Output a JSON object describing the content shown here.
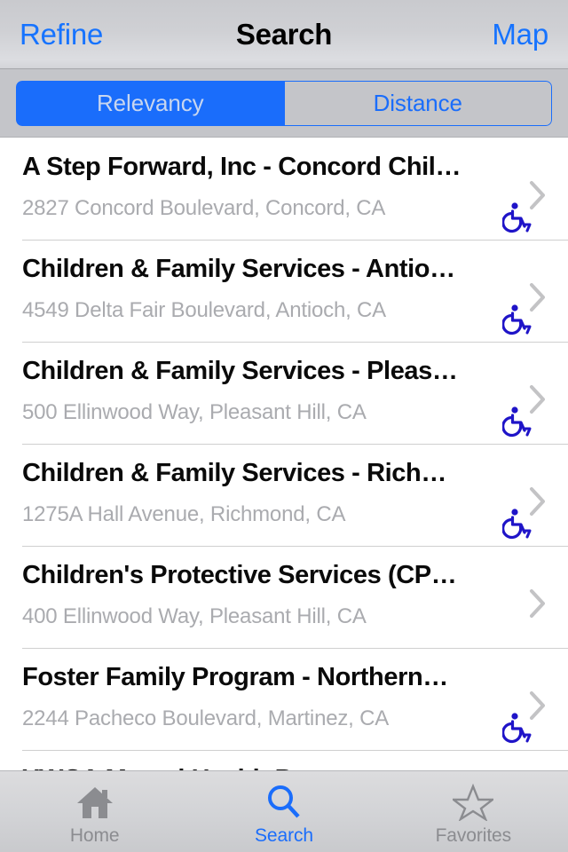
{
  "navbar": {
    "left_button": "Refine",
    "title": "Search",
    "right_button": "Map",
    "tint_color": "#1673ff"
  },
  "segmented_control": {
    "selected_index": 0,
    "active_color": "#1a6dfb",
    "segments": [
      {
        "label": "Relevancy",
        "selected": true
      },
      {
        "label": "Distance",
        "selected": false
      }
    ]
  },
  "list": {
    "chevron_icon": "chevron-right-icon",
    "accessible_icon": "wheelchair-accessible-icon",
    "accessible_icon_color": "#1f14c8",
    "rows": [
      {
        "title": "A Step Forward, Inc - Concord Chil…",
        "address": "2827 Concord Boulevard, Concord, CA",
        "accessible": true
      },
      {
        "title": "Children & Family Services - Antio…",
        "address": "4549 Delta Fair Boulevard, Antioch, CA",
        "accessible": true
      },
      {
        "title": "Children & Family Services - Pleas…",
        "address": "500 Ellinwood Way, Pleasant Hill, CA",
        "accessible": true
      },
      {
        "title": "Children & Family Services - Rich…",
        "address": "1275A Hall Avenue, Richmond, CA",
        "accessible": true
      },
      {
        "title": "Children's Protective Services (CP…",
        "address": "400 Ellinwood Way, Pleasant Hill, CA",
        "accessible": false
      },
      {
        "title": "Foster Family Program - Northern…",
        "address": "2244 Pacheco Boulevard, Martinez, CA",
        "accessible": true
      },
      {
        "title": "YWCA Mental Health Program",
        "address": "",
        "accessible": false
      }
    ]
  },
  "tabbar": {
    "tabs": [
      {
        "label": "Home",
        "icon": "home-icon",
        "active": false
      },
      {
        "label": "Search",
        "icon": "search-icon",
        "active": true
      },
      {
        "label": "Favorites",
        "icon": "star-icon",
        "active": false
      }
    ]
  }
}
